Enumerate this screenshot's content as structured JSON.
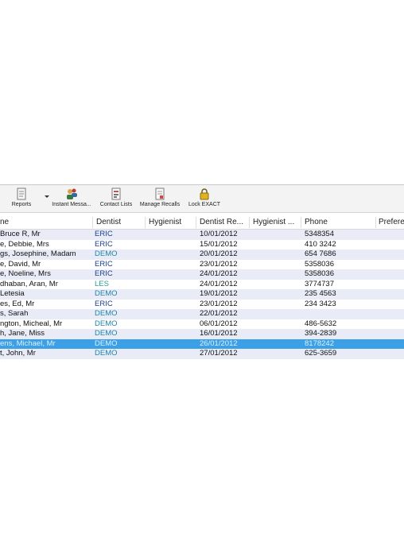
{
  "toolbar": {
    "reports_label": "Reports",
    "instant_label": "Instant Messa...",
    "contact_label": "Contact Lists",
    "recalls_label": "Manage Recalls",
    "lock_label": "Lock EXACT"
  },
  "table": {
    "headers": [
      "ne",
      "Dentist",
      "Hygienist",
      "Dentist Re...",
      "Hygienist ...",
      "Phone",
      "Prefere"
    ],
    "rows": [
      {
        "name": " Bruce R, Mr",
        "dentist": "ERIC",
        "dentist_recall": "10/01/2012",
        "phone": "5348354"
      },
      {
        "name": "e, Debbie, Mrs",
        "dentist": "ERIC",
        "dentist_recall": "15/01/2012",
        "phone": "410 3242"
      },
      {
        "name": "gs, Josephine, Madam",
        "dentist": "DEMO",
        "dentist_recall": "20/01/2012",
        "phone": "654 7686"
      },
      {
        "name": "e, David, Mr",
        "dentist": "ERIC",
        "dentist_recall": "23/01/2012",
        "phone": "5358036"
      },
      {
        "name": "e, Noeline, Mrs",
        "dentist": "ERIC",
        "dentist_recall": "24/01/2012",
        "phone": "5358036"
      },
      {
        "name": "dhaban, Aran, Mr",
        "dentist": "LES",
        "dentist_recall": "24/01/2012",
        "phone": "3774737"
      },
      {
        "name": "Letesia",
        "dentist": "DEMO",
        "dentist_recall": "19/01/2012",
        "phone": "235 4563"
      },
      {
        "name": "es, Ed, Mr",
        "dentist": "ERIC",
        "dentist_recall": "23/01/2012",
        "phone": "234 3423"
      },
      {
        "name": "s, Sarah",
        "dentist": "DEMO",
        "dentist_recall": "22/01/2012",
        "phone": ""
      },
      {
        "name": "ngton, Micheal, Mr",
        "dentist": "DEMO",
        "dentist_recall": "06/01/2012",
        "phone": "486-5632"
      },
      {
        "name": "h, Jane, Miss",
        "dentist": "DEMO",
        "dentist_recall": "16/01/2012",
        "phone": "394-2839"
      },
      {
        "name": "ens, Michael, Mr",
        "dentist": "DEMO",
        "dentist_recall": "26/01/2012",
        "phone": "8178242",
        "selected": true
      },
      {
        "name": "t, John, Mr",
        "dentist": "DEMO",
        "dentist_recall": "27/01/2012",
        "phone": "625-3659"
      }
    ]
  }
}
